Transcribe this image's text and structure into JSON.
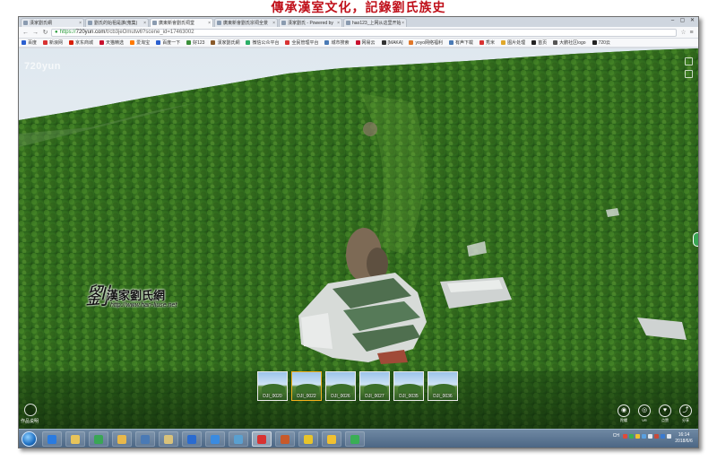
{
  "banner": {
    "text": "傳承漢室文化，記錄劉氏族史"
  },
  "browser": {
    "tabs": [
      {
        "label": "漢家劉氏網",
        "active": false
      },
      {
        "label": "劉氏的始祖是誰(蒐集)",
        "active": false
      },
      {
        "label": "廣東新會劉氏祠堂",
        "active": true
      },
      {
        "label": "廣東新會劉氏宗祠全景",
        "active": false
      },
      {
        "label": "漢家劉氏 - Powered by",
        "active": false
      },
      {
        "label": "hao123_上网从这里开始",
        "active": false
      }
    ],
    "window_controls": [
      "–",
      "▢",
      "✕"
    ],
    "address": {
      "protocol": "https://",
      "host": "720yun.com",
      "path": "/t/cb3jeOmutw6?scene_id=17463002"
    },
    "bookmarks": [
      {
        "label": "百度",
        "color": "#2a5fd0"
      },
      {
        "label": "新浪网",
        "color": "#d83232"
      },
      {
        "label": "京东商城",
        "color": "#d81e06"
      },
      {
        "label": "天猫精选",
        "color": "#c8102e"
      },
      {
        "label": "爱淘宝",
        "color": "#ff7a00"
      },
      {
        "label": "百度一下",
        "color": "#2a5fd0"
      },
      {
        "label": "好123",
        "color": "#3a8f3a"
      },
      {
        "label": "漢家劉氏網",
        "color": "#8a5a2a"
      },
      {
        "label": "微信公众平台",
        "color": "#2aae67"
      },
      {
        "label": "全民管理平台",
        "color": "#d83232"
      },
      {
        "label": "城市搜索",
        "color": "#4a7ab5"
      },
      {
        "label": "网易云",
        "color": "#c8102e"
      },
      {
        "label": "[MAKA]",
        "color": "#333333"
      },
      {
        "label": "yoyo网络福利",
        "color": "#e0782a"
      },
      {
        "label": "有声下载",
        "color": "#4a7ab5"
      },
      {
        "label": "秀米",
        "color": "#d83232"
      },
      {
        "label": "图片处理",
        "color": "#e0a72a"
      },
      {
        "label": "首页",
        "color": "#222222"
      },
      {
        "label": "大鹏社区logo",
        "color": "#555555"
      },
      {
        "label": "720云",
        "color": "#222222"
      }
    ]
  },
  "pano": {
    "logo": "720yun",
    "watermark": {
      "seal": "劉",
      "name": "漢家劉氏網",
      "url": "http://www.han-liuse.net"
    }
  },
  "scenes": [
    {
      "label": "DJI_0020",
      "active": false
    },
    {
      "label": "DJI_0022",
      "active": true
    },
    {
      "label": "DJI_0026",
      "active": false
    },
    {
      "label": "DJI_0027",
      "active": false
    },
    {
      "label": "DJI_0035",
      "active": false
    },
    {
      "label": "DJI_0036",
      "active": false
    }
  ],
  "controls": {
    "bottom_left_label": "作品说明",
    "bottom_right": [
      {
        "icon": "◉",
        "label": "陀螺"
      },
      {
        "icon": "◎",
        "label": "VR"
      },
      {
        "icon": "♥",
        "label": "点赞"
      },
      {
        "icon": "⤴",
        "label": "分享"
      }
    ]
  },
  "taskbar": {
    "apps": [
      {
        "name": "ie-browser",
        "color": "#2a7be0"
      },
      {
        "name": "file-explorer",
        "color": "#e8c45a"
      },
      {
        "name": "360-browser",
        "color": "#3aa655"
      },
      {
        "name": "folder",
        "color": "#e8b84a"
      },
      {
        "name": "media-player",
        "color": "#4a7ab5"
      },
      {
        "name": "library",
        "color": "#d9c27a"
      },
      {
        "name": "photoshop",
        "color": "#2a6bd0"
      },
      {
        "name": "ie-tab",
        "color": "#3a8be0"
      },
      {
        "name": "app-notes",
        "color": "#5aa0d0"
      },
      {
        "name": "chrome",
        "color": "#d83232"
      },
      {
        "name": "paint",
        "color": "#c85a2a"
      },
      {
        "name": "wps",
        "color": "#e8c42a"
      },
      {
        "name": "qq",
        "color": "#f0c030"
      },
      {
        "name": "wechat",
        "color": "#3aae55"
      }
    ],
    "ime": "CH",
    "clock_time": "16:14",
    "clock_date": "2018/6/6"
  }
}
